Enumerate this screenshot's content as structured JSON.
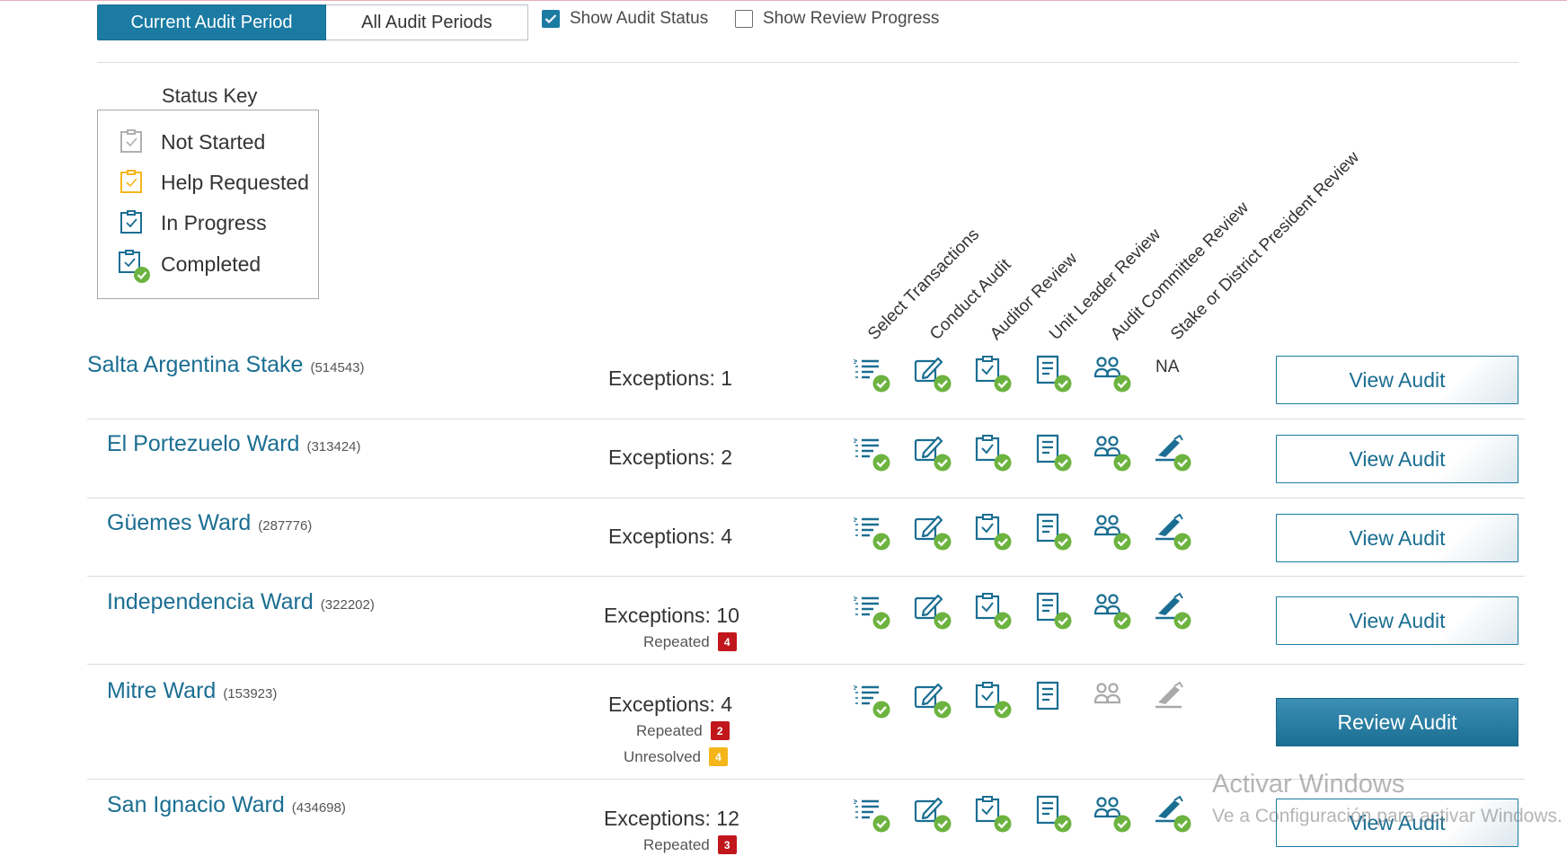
{
  "toggle": {
    "current": "Current Audit Period",
    "all": "All Audit Periods"
  },
  "options": {
    "show_audit_status": {
      "label": "Show Audit Status",
      "checked": true
    },
    "show_review_progress": {
      "label": "Show Review Progress",
      "checked": false
    }
  },
  "status_key": {
    "title": "Status Key",
    "items": [
      {
        "label": "Not Started",
        "color": "#b0b0b0",
        "icon": "checklist-icon"
      },
      {
        "label": "Help Requested",
        "color": "#f5b61b",
        "icon": "checklist-icon"
      },
      {
        "label": "In Progress",
        "color": "#1b6e92",
        "icon": "checklist-icon"
      },
      {
        "label": "Completed",
        "color": "#1b6e92",
        "icon": "checklist-completed-icon"
      }
    ]
  },
  "columns": [
    "Select Transactions",
    "Conduct Audit",
    "Auditor Review",
    "Unit Leader Review",
    "Audit Committee Review",
    "Stake or District President Review"
  ],
  "colors": {
    "accent": "#1b7ba3",
    "complete": "#6cb33f",
    "not_started": "#b0b0b0",
    "repeated": "#c0161c",
    "unresolved": "#f5b61b"
  },
  "units": [
    {
      "name": "Salta Argentina Stake",
      "number": "(514543)",
      "exceptions": "Exceptions: 1",
      "statuses": [
        "complete",
        "complete",
        "complete",
        "complete",
        "complete",
        "na"
      ],
      "na_label": "NA",
      "action": "View Audit"
    },
    {
      "name": "El Portezuelo Ward",
      "number": "(313424)",
      "exceptions": "Exceptions: 2",
      "statuses": [
        "complete",
        "complete",
        "complete",
        "complete",
        "complete",
        "complete"
      ],
      "action": "View Audit"
    },
    {
      "name": "Güemes Ward",
      "number": "(287776)",
      "exceptions": "Exceptions: 4",
      "statuses": [
        "complete",
        "complete",
        "complete",
        "complete",
        "complete",
        "complete"
      ],
      "action": "View Audit"
    },
    {
      "name": "Independencia Ward",
      "number": "(322202)",
      "exceptions": "Exceptions: 10",
      "repeated_label": "Repeated",
      "repeated": "4",
      "statuses": [
        "complete",
        "complete",
        "complete",
        "complete",
        "complete",
        "complete"
      ],
      "action": "View Audit"
    },
    {
      "name": "Mitre Ward",
      "number": "(153923)",
      "exceptions": "Exceptions: 4",
      "repeated_label": "Repeated",
      "repeated": "2",
      "unresolved_label": "Unresolved",
      "unresolved": "4",
      "statuses": [
        "complete",
        "complete",
        "complete",
        "in_progress",
        "not_started",
        "not_started"
      ],
      "action": "Review Audit"
    },
    {
      "name": "San Ignacio Ward",
      "number": "(434698)",
      "exceptions": "Exceptions: 12",
      "repeated_label": "Repeated",
      "repeated": "3",
      "statuses": [
        "complete",
        "complete",
        "complete",
        "complete",
        "complete",
        "complete"
      ],
      "action": "View Audit"
    }
  ],
  "watermark": {
    "line1": "Activar Windows",
    "line2": "Ve a Configuración para activar Windows."
  }
}
